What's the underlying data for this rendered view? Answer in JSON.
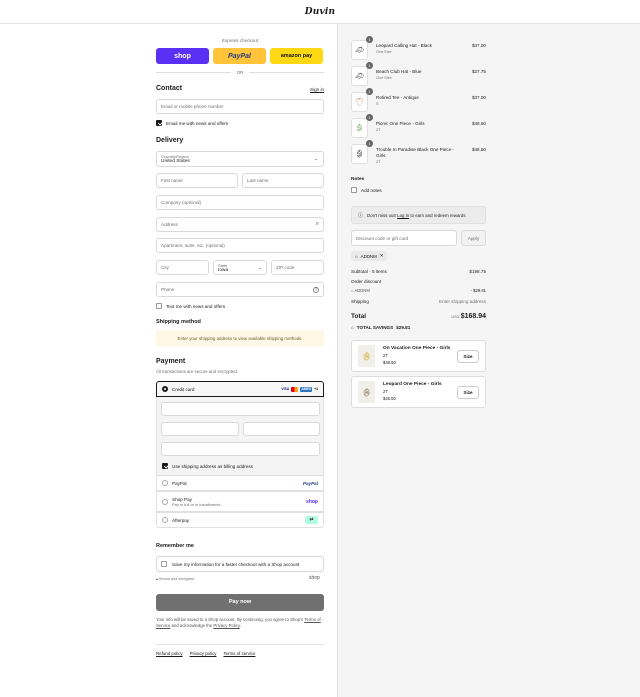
{
  "brand": {
    "logo": "Duvin"
  },
  "express": {
    "label": "Express checkout",
    "shop": "shop",
    "paypal": "PayPal",
    "amazon": "amazon pay",
    "or": "OR"
  },
  "contact": {
    "title": "Contact",
    "sign_in": "Sign in",
    "email_placeholder": "Email or mobile phone number",
    "newsletter": "Email me with news and offers"
  },
  "delivery": {
    "title": "Delivery",
    "country_label": "Country/Region",
    "country_value": "United States",
    "first_name": "First name",
    "last_name": "Last name",
    "company": "Company (optional)",
    "address": "Address",
    "apartment": "Apartment, suite, etc. (optional)",
    "city": "City",
    "state_label": "State",
    "state_value": "Iowa",
    "zip": "ZIP code",
    "phone": "Phone",
    "text_me": "Text me with news and offers"
  },
  "shipping": {
    "title": "Shipping method",
    "notice": "Enter your shipping address to view available shipping methods."
  },
  "payment": {
    "title": "Payment",
    "subtitle": "All transactions are secure and encrypted.",
    "credit_card": "Credit card",
    "card_brands": [
      "VISA",
      "MC",
      "AMEX",
      "+4"
    ],
    "billing_same": "Use shipping address as billing address",
    "paypal": "PayPal",
    "paypal_logo": "PayPal",
    "shop_pay": "Shop Pay",
    "shop_pay_sub": "Pay in full or in installments",
    "shop_pay_logo": "shop",
    "afterpay": "Afterpay"
  },
  "remember": {
    "title": "Remember me",
    "save_info": "Save my information for a faster checkout with a Shop account",
    "secure": "Secure and encrypted",
    "shop_logo": "shop"
  },
  "pay_now": "Pay now",
  "legal": {
    "text1": "Your info will be saved to a Shop account. By continuing, you agree to Shop's",
    "terms": "Terms of Service",
    "text2": "and acknowledge the",
    "privacy": "Privacy Policy",
    "end": "."
  },
  "footer": {
    "refund": "Refund policy",
    "privacy": "Privacy policy",
    "terms": "Terms of service"
  },
  "cart": {
    "items": [
      {
        "qty": "1",
        "name": "Leopard Calling Hat - Black",
        "variant": "One Size",
        "price": "$37.00",
        "icon": "hat-icon"
      },
      {
        "qty": "1",
        "name": "Beach Club Hat - Blue",
        "variant": "One Size",
        "price": "$27.75",
        "icon": "hat-icon"
      },
      {
        "qty": "1",
        "name": "Retired Tee - Antique",
        "variant": "S",
        "price": "$37.00",
        "icon": "tee-icon"
      },
      {
        "qty": "1",
        "name": "Picnic One Piece - Girls",
        "variant": "2T",
        "price": "$48.50",
        "icon": "swimsuit-icon"
      },
      {
        "qty": "1",
        "name": "Trouble In Paradise Black One Piece - Girls",
        "variant": "2T",
        "price": "$48.50",
        "icon": "swimsuit-icon"
      }
    ],
    "notes_title": "Notes",
    "add_notes": "Add notes",
    "rewards_pre": "Don't miss out!",
    "rewards_link": "Log in",
    "rewards_post": "to earn and redeem rewards",
    "discount_placeholder": "Discount code or gift card",
    "apply": "Apply",
    "code": "ADDNM",
    "subtotal_label": "Subtotal · 5 items",
    "subtotal": "$198.75",
    "order_discount": "Order discount",
    "discount_code": "ADDNM",
    "discount_amount": "- $29.81",
    "shipping_label": "Shipping",
    "shipping_value": "Enter shipping address",
    "total_label": "Total",
    "currency": "USD",
    "total": "$168.94",
    "savings_label": "TOTAL SAVINGS",
    "savings": "$29.81",
    "upsells": [
      {
        "name": "On Vacation One Piece - Girls",
        "size": "2T",
        "price": "$48.50",
        "button": "Size"
      },
      {
        "name": "Leopard One Piece - Girls",
        "size": "2T",
        "price": "$48.50",
        "button": "Size"
      }
    ]
  },
  "colors": {
    "shop": "#5a31f4",
    "paypal": "#ffc439",
    "amazon": "#ffd814",
    "pay_button": "#707070"
  }
}
